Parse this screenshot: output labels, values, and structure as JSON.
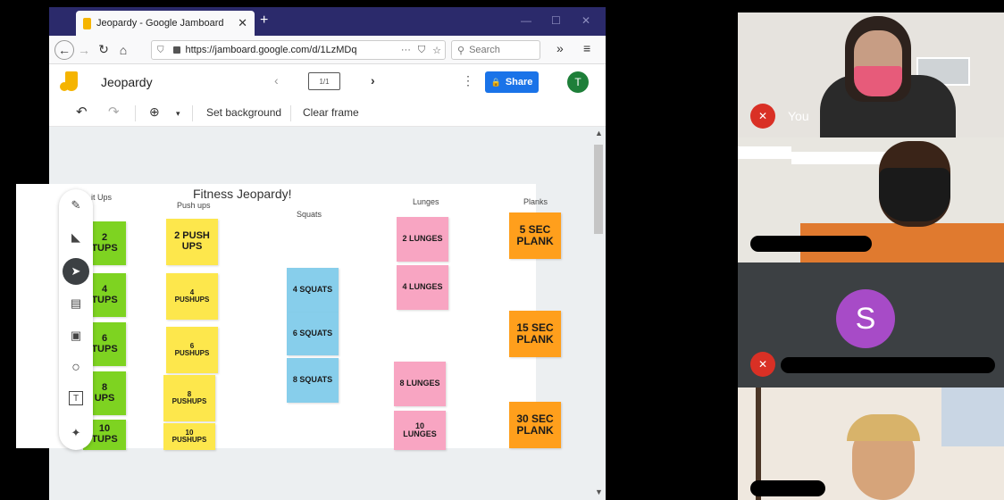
{
  "browser": {
    "tab_title": "Jeopardy - Google Jamboard",
    "tab_close": "✕",
    "new_tab": "+",
    "minimize": "—",
    "maximize": "☐",
    "close": "✕",
    "back": "←",
    "forward": "→",
    "reload": "↻",
    "home": "⌂",
    "url": "https://jamboard.google.com/d/1LzMDq",
    "url_tail": "···",
    "search_placeholder": "Search",
    "overflow": "»",
    "menu": "≡"
  },
  "jamboard": {
    "title": "Jeopardy",
    "frame_indicator": "1/1",
    "prev": "‹",
    "next": "›",
    "more": "⋮",
    "share_label": "Share",
    "avatar_letter": "T",
    "toolbar": {
      "undo": "↶",
      "redo": "↷",
      "zoom": "⊕",
      "zoom_dropdown": "▾",
      "set_background": "Set background",
      "clear_frame": "Clear frame"
    }
  },
  "board": {
    "title": "Fitness Jeopardy!",
    "columns": {
      "situps": "it Ups",
      "pushups": "Push ups",
      "squats": "Squats",
      "lunges": "Lunges",
      "planks": "Planks"
    },
    "notes": {
      "situps": [
        "2\nTUPS",
        "4\nTUPS",
        "6\nTUPS",
        "8\nUPS",
        "10\nTUPS"
      ],
      "pushups": [
        "2 PUSH\nUPS",
        "4\nPUSHUPS",
        "6\nPUSHUPS",
        "8\nPUSHUPS",
        "10\nPUSHUPS"
      ],
      "squats": [
        "4 SQUATS",
        "6 SQUATS",
        "8 SQUATS"
      ],
      "lunges": [
        "2 LUNGES",
        "4 LUNGES",
        "8 LUNGES",
        "10\nLUNGES"
      ],
      "planks": [
        "5 SEC\nPLANK",
        "15 SEC\nPLANK",
        "30 SEC\nPLANK"
      ]
    }
  },
  "palette": {
    "pen": "✎",
    "eraser": "◣",
    "select": "➤",
    "sticky": "▤",
    "image": "▣",
    "circle": "○",
    "textbox": "T",
    "laser": "✦"
  },
  "video": {
    "you_label": "You",
    "s_initial": "S",
    "mute_glyph": "🎙"
  },
  "colors": {
    "tabbar": "#2b2a6b",
    "share": "#1a73e8",
    "avatar_t": "#1e7f39",
    "s_avatar": "#a74bc7",
    "mute": "#d93025"
  }
}
